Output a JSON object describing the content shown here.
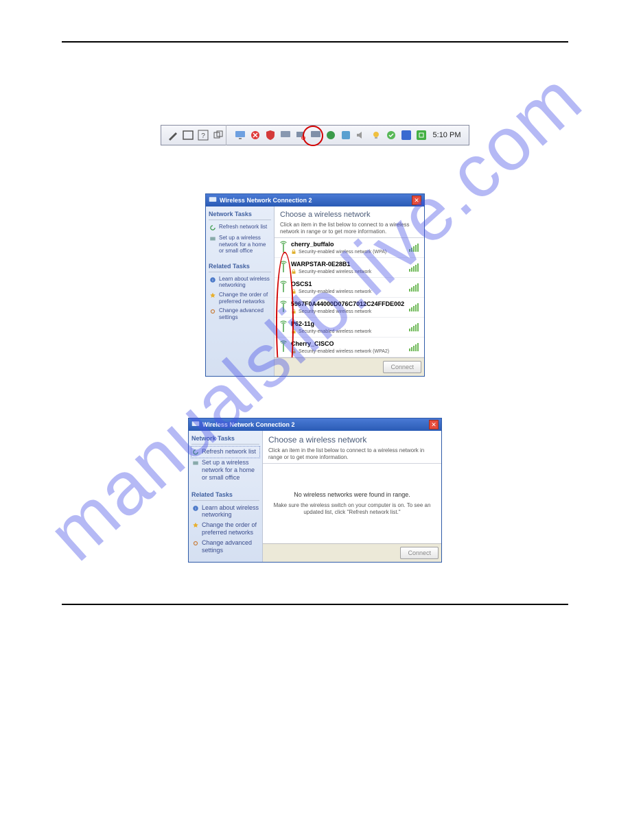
{
  "watermark": "manualslib.live.com",
  "taskbar": {
    "clock": "5:10 PM"
  },
  "window_a": {
    "title": "Wireless Network Connection 2",
    "side": {
      "tasks_hdr": "Network Tasks",
      "refresh": "Refresh network list",
      "setup": "Set up a wireless network for a home or small office",
      "related_hdr": "Related Tasks",
      "learn": "Learn about wireless networking",
      "order": "Change the order of preferred networks",
      "adv": "Change advanced settings"
    },
    "main_hdr": "Choose a wireless network",
    "main_sub": "Click an item in the list below to connect to a wireless network in range or to get more information.",
    "networks": [
      {
        "name": "cherry_buffalo",
        "sec": "Security-enabled wireless network (WPA)"
      },
      {
        "name": "WARPSTAR-0E28B1",
        "sec": "Security-enabled wireless network"
      },
      {
        "name": "OSCS1",
        "sec": "Security-enabled wireless network"
      },
      {
        "name": "5967F0A44000D076C7012C24FFDE002",
        "sec": "Security-enabled wireless network"
      },
      {
        "name": "P62-11g",
        "sec": "Security-enabled wireless network"
      },
      {
        "name": "Cherry_CISCO",
        "sec": "Security-enabled wireless network (WPA2)"
      }
    ],
    "connect": "Connect"
  },
  "window_b": {
    "title": "Wireless Network Connection 2",
    "side": {
      "tasks_hdr": "Network Tasks",
      "refresh": "Refresh network list",
      "setup": "Set up a wireless network for a home or small office",
      "related_hdr": "Related Tasks",
      "learn": "Learn about wireless networking",
      "order": "Change the order of preferred networks",
      "adv": "Change advanced settings"
    },
    "main_hdr": "Choose a wireless network",
    "main_sub": "Click an item in the list below to connect to a wireless network in range or to get more information.",
    "empty1": "No wireless networks were found in range.",
    "empty2": "Make sure the wireless switch on your computer is on.\nTo see an updated list, click \"Refresh network list.\"",
    "connect": "Connect"
  }
}
